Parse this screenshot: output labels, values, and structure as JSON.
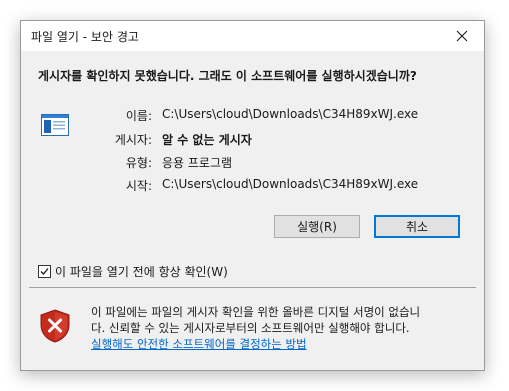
{
  "window": {
    "title": "파일 열기 - 보안 경고",
    "close_icon": "close-icon"
  },
  "dialog": {
    "question": "게시자를 확인하지 못했습니다.  그래도 이 소프트웨어를 실행하시겠습니까?",
    "file_icon": "application-icon",
    "info": {
      "name_label": "이름:",
      "name_value": "C:\\Users\\cloud\\Downloads\\C34H89xWJ.exe",
      "publisher_label": "게시자:",
      "publisher_value": "알 수 없는 게시자",
      "type_label": "유형:",
      "type_value": "응용 프로그램",
      "from_label": "시작:",
      "from_value": "C:\\Users\\cloud\\Downloads\\C34H89xWJ.exe"
    },
    "buttons": {
      "run_label": "실행(R)",
      "cancel_label": "취소"
    },
    "checkbox": {
      "label": "이 파일을 열기 전에 항상 확인(W)",
      "checked": true
    },
    "warning": {
      "icon": "shield-error-icon",
      "line1": "이 파일에는 파일의 게시자 확인을 위한 올바른 디지털 서명이 없습니",
      "line2": "다.  신뢰할 수 있는 게시자로부터의 소프트웨어만 실행해야 합니다.",
      "link": "실행해도 안전한 소프트웨어를 결정하는 방법"
    }
  },
  "colors": {
    "dialog_bg": "#f0f0f0",
    "titlebar_bg": "#ffffff",
    "accent": "#0078d7",
    "link": "#0066cc",
    "shield_red": "#c42b1c"
  }
}
